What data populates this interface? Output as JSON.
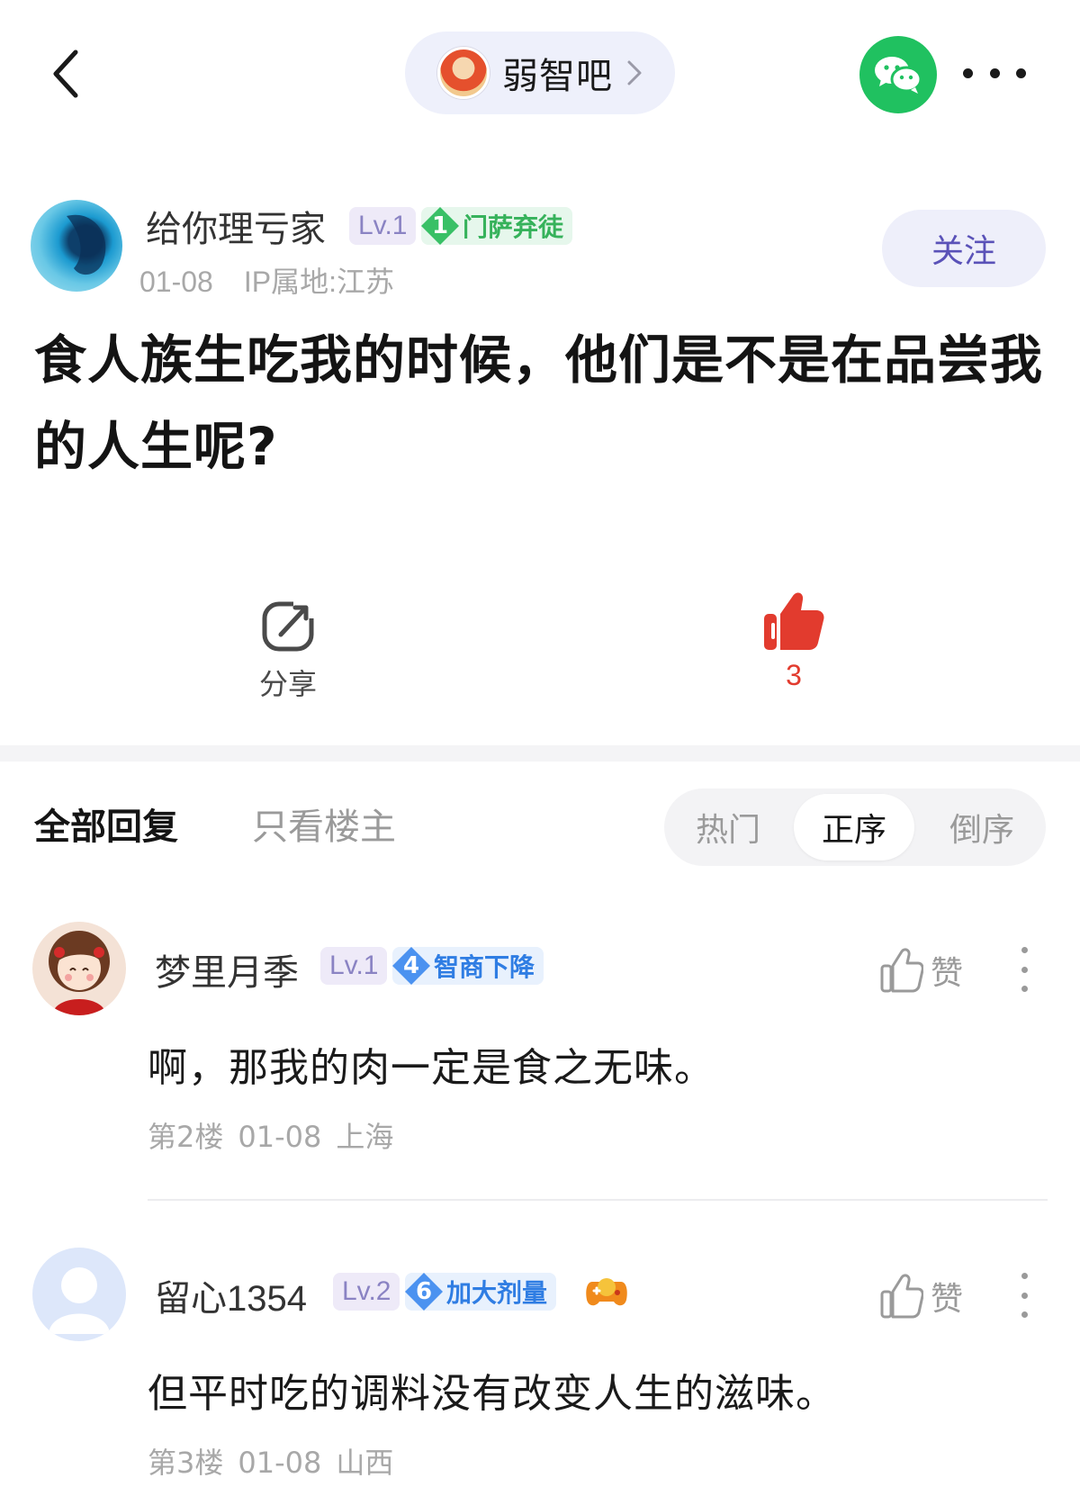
{
  "header": {
    "forum_name": "弱智吧"
  },
  "post": {
    "author": {
      "name": "给你理亏家",
      "level": "Lv.1",
      "honor_level": "1",
      "honor_title": "门萨弃徒",
      "date": "01-08",
      "ip_location": "IP属地:江苏",
      "follow_label": "关注"
    },
    "title": "食人族生吃我的时候，他们是不是在品尝我的人生呢?",
    "actions": {
      "share_label": "分享",
      "like_count": "3"
    }
  },
  "tabs": {
    "all_replies": "全部回复",
    "op_only": "只看楼主",
    "sort": {
      "hot": "热门",
      "ascending": "正序",
      "descending": "倒序",
      "selected": "正序"
    }
  },
  "comments": [
    {
      "name": "梦里月季",
      "level": "Lv.1",
      "honor_level": "4",
      "honor_title": "智商下降",
      "like_label": "赞",
      "text": "啊，那我的肉一定是食之无味。",
      "floor": "第2楼",
      "date": "01-08",
      "location": "上海"
    },
    {
      "name": "留心1354",
      "level": "Lv.2",
      "honor_level": "6",
      "honor_title": "加大剂量",
      "like_label": "赞",
      "text": "但平时吃的调料没有改变人生的滋味。",
      "floor": "第3楼",
      "date": "01-08",
      "location": "山西"
    }
  ],
  "colors": {
    "accent_purple": "#5a52b8",
    "like_red": "#e23b2e",
    "wechat_green": "#20c160",
    "honor_green": "#36b25b",
    "honor_blue": "#2f7de3"
  },
  "icons": [
    "back-icon",
    "chevron-right-icon",
    "wechat-icon",
    "more-icon",
    "share-icon",
    "thumbs-up-icon",
    "game-controller-icon"
  ]
}
